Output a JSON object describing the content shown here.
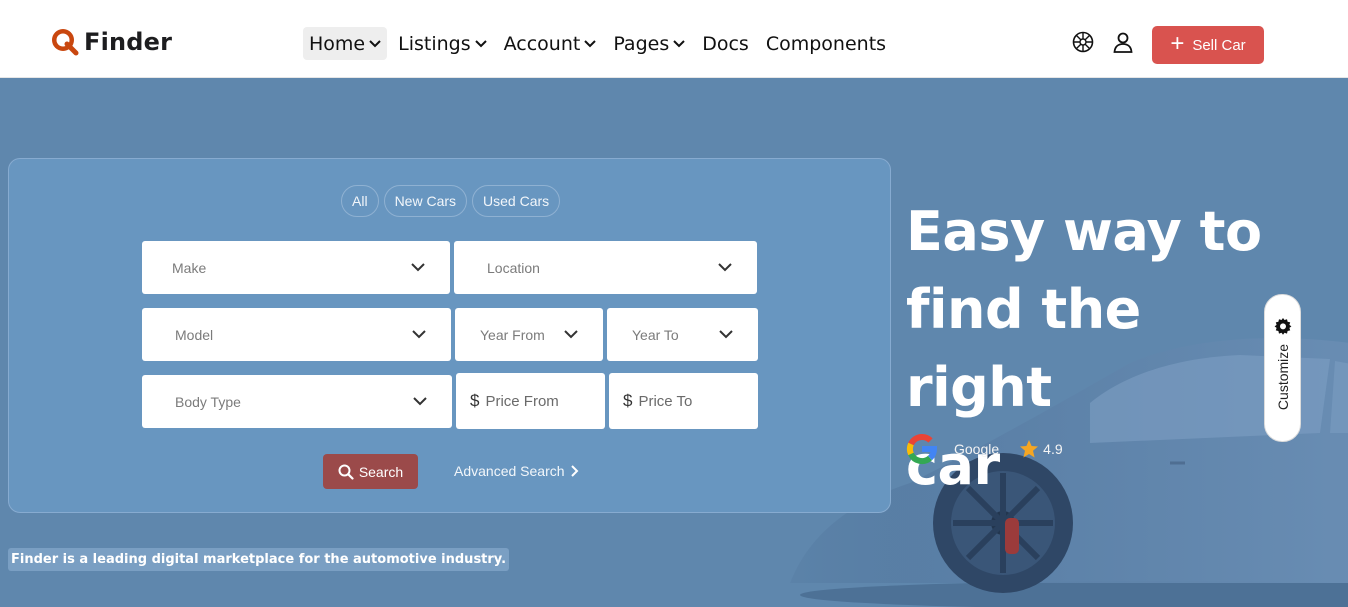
{
  "brand": {
    "name": "Finder"
  },
  "nav": {
    "items": [
      {
        "label": "Home",
        "has_dropdown": true,
        "active": true
      },
      {
        "label": "Listings",
        "has_dropdown": true
      },
      {
        "label": "Account",
        "has_dropdown": true
      },
      {
        "label": "Pages",
        "has_dropdown": true
      },
      {
        "label": "Docs",
        "has_dropdown": false
      },
      {
        "label": "Components",
        "has_dropdown": false
      }
    ]
  },
  "header": {
    "icons": [
      "globe-icon",
      "user-icon"
    ],
    "sell_label": "Sell Car"
  },
  "search": {
    "tabs": [
      "All",
      "New Cars",
      "Used Cars"
    ],
    "make": "Make",
    "location": "Location",
    "model": "Model",
    "year_from": "Year From",
    "year_to": "Year To",
    "body_type": "Body Type",
    "price_from": "Price From",
    "price_to": "Price To",
    "search_label": "Search",
    "advanced_label": "Advanced Search"
  },
  "hero": {
    "headline_lines": [
      "Easy way to",
      "find the right",
      "car"
    ],
    "review_source": "Google",
    "rating": "4.9",
    "tagline": "Finder is a leading digital marketplace for the automotive industry."
  },
  "customize": {
    "label": "Customize"
  },
  "colors": {
    "accent": "#d9534f",
    "hero_bg": "#5f87ad",
    "panel_bg": "#6896c0",
    "search_button": "#9b4a4a",
    "brand_orange": "#c9470f"
  }
}
